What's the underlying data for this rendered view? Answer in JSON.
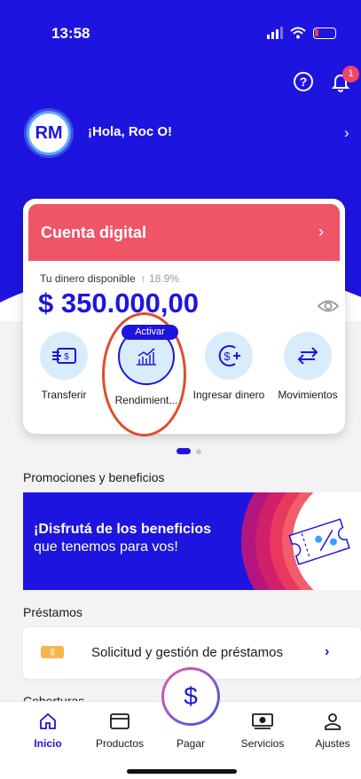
{
  "status_bar": {
    "time": "13:58"
  },
  "header": {
    "notification_count": "1",
    "help_glyph": "?"
  },
  "user": {
    "initials": "RM",
    "greeting": "¡Hola, Roc O!"
  },
  "account_card": {
    "title": "Cuenta digital",
    "available_label": "Tu dinero disponible",
    "change": "↑ 18.9%",
    "balance": "$ 350.000,00",
    "actions": [
      {
        "label": "Transferir",
        "icon": "transfer-icon"
      },
      {
        "label": "Rendimient...",
        "icon": "growth-chart-icon",
        "pill": "Activar"
      },
      {
        "label": "Ingresar dinero",
        "icon": "deposit-icon"
      },
      {
        "label": "Movimientos",
        "icon": "arrows-exchange-icon"
      }
    ]
  },
  "promotions": {
    "section_title": "Promociones y beneficios",
    "banner_line1": "¡Disfrutá de los beneficios",
    "banner_line2": "que tenemos para vos!"
  },
  "loans": {
    "section_title": "Préstamos",
    "item_label": "Solicitud y gestión de préstamos",
    "coin_glyph": "$"
  },
  "coverage": {
    "section_title": "Coberturas"
  },
  "tabbar": {
    "items": [
      {
        "label": "Inicio",
        "active": true
      },
      {
        "label": "Productos"
      },
      {
        "label": "Pagar"
      },
      {
        "label": "Servicios"
      },
      {
        "label": "Ajustes"
      }
    ],
    "pay_glyph": "$"
  },
  "colors": {
    "brand_blue": "#1e14e0",
    "card_header": "#ef5467",
    "highlight": "#e24b2b"
  }
}
